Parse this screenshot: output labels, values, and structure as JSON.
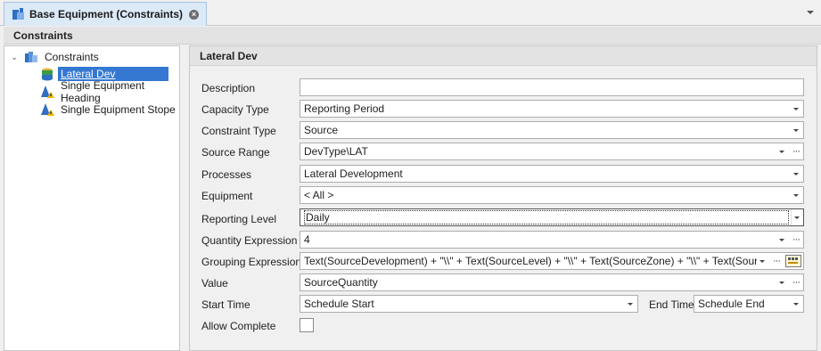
{
  "tab": {
    "title": "Base Equipment (Constraints)",
    "close_glyph": "×"
  },
  "group": {
    "title": "Constraints"
  },
  "tree": {
    "root": {
      "label": "Constraints",
      "expander": "⌄"
    },
    "items": [
      {
        "label": "Lateral Dev"
      },
      {
        "label": "Single Equipment Heading"
      },
      {
        "label": "Single Equipment Stope"
      }
    ]
  },
  "details": {
    "title": "Lateral Dev",
    "fields": {
      "description": {
        "label": "Description",
        "value": ""
      },
      "capacity_type": {
        "label": "Capacity Type",
        "value": "Reporting Period"
      },
      "constraint_type": {
        "label": "Constraint Type",
        "value": "Source"
      },
      "source_range": {
        "label": "Source Range",
        "value": "DevType\\LAT"
      },
      "processes": {
        "label": "Processes",
        "value": "Lateral Development"
      },
      "equipment": {
        "label": "Equipment",
        "value": "< All >"
      },
      "reporting_level": {
        "label": "Reporting Level",
        "value": "Daily"
      },
      "quantity_expression": {
        "label": "Quantity Expression",
        "value": "4"
      },
      "grouping_expression": {
        "label": "Grouping Expression",
        "value": "Text(SourceDevelopment) + \"\\\\\" + Text(SourceLevel) + \"\\\\\" + Text(SourceZone) + \"\\\\\" + Text(SourceId)"
      },
      "value": {
        "label": "Value",
        "value": "SourceQuantity"
      },
      "start_time": {
        "label": "Start Time",
        "value": "Schedule Start"
      },
      "end_time": {
        "label": "End Time",
        "value": "Schedule End"
      },
      "allow_complete": {
        "label": "Allow Complete",
        "checked": false
      }
    },
    "ellipsis": "···"
  },
  "icons": {
    "tab": "equipment-icon",
    "root": "constraints-folder-icon",
    "lateral_dev": "stack-icon",
    "heading": "warning-constraint-icon",
    "stope": "warning-constraint-icon",
    "expression_builder": "expression-builder-icon"
  },
  "colors": {
    "selection": "#3478d2",
    "tab_active": "#dce9f7"
  }
}
